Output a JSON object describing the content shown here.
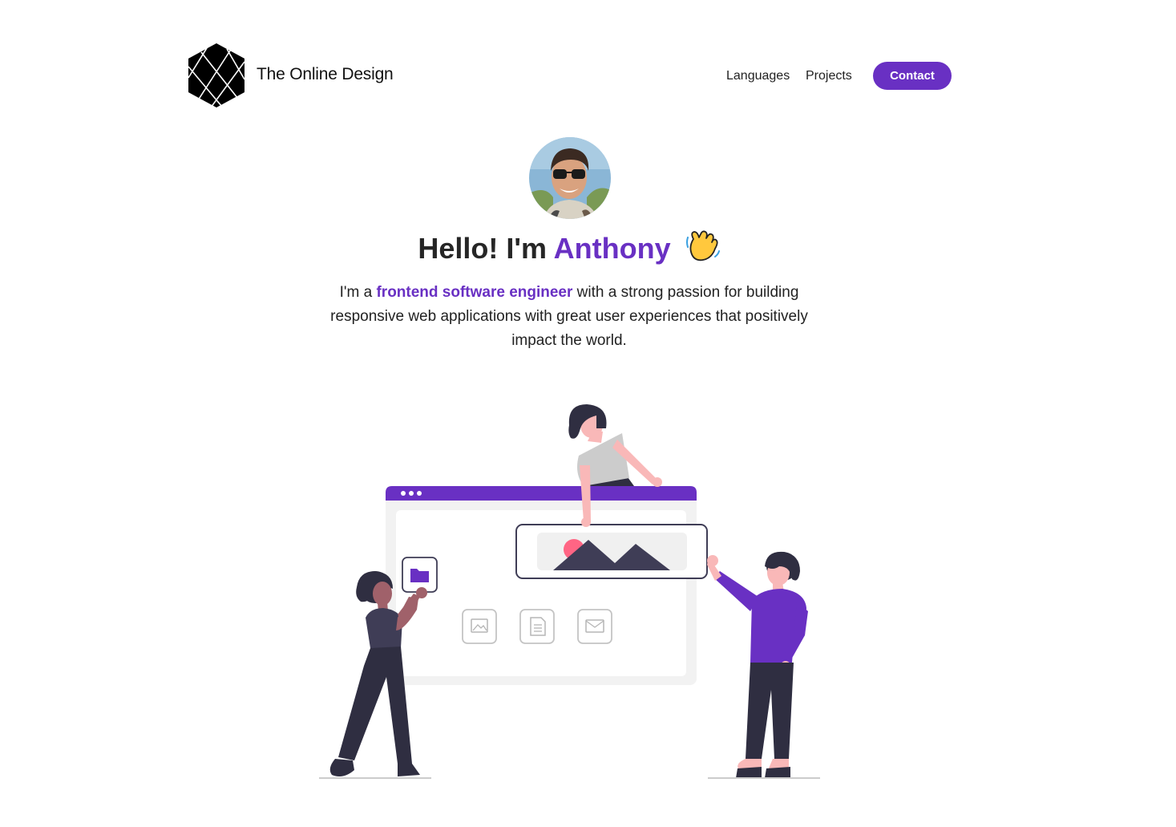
{
  "header": {
    "brand": "The Online Design",
    "nav": [
      {
        "label": "Languages"
      },
      {
        "label": "Projects"
      }
    ],
    "contact_label": "Contact"
  },
  "hero": {
    "greeting": "Hello! I'm",
    "name": "Anthony",
    "wave_icon": "waving-hand-icon",
    "intro_before": "I'm a",
    "intro_highlight": "frontend software engineer",
    "intro_after": "with a strong passion for building responsive web applications with great user experiences that positively impact the world."
  },
  "colors": {
    "accent": "#6930c3",
    "text": "#222222",
    "illustration_dark": "#2f2e41",
    "skin": "#f9b8b8"
  }
}
